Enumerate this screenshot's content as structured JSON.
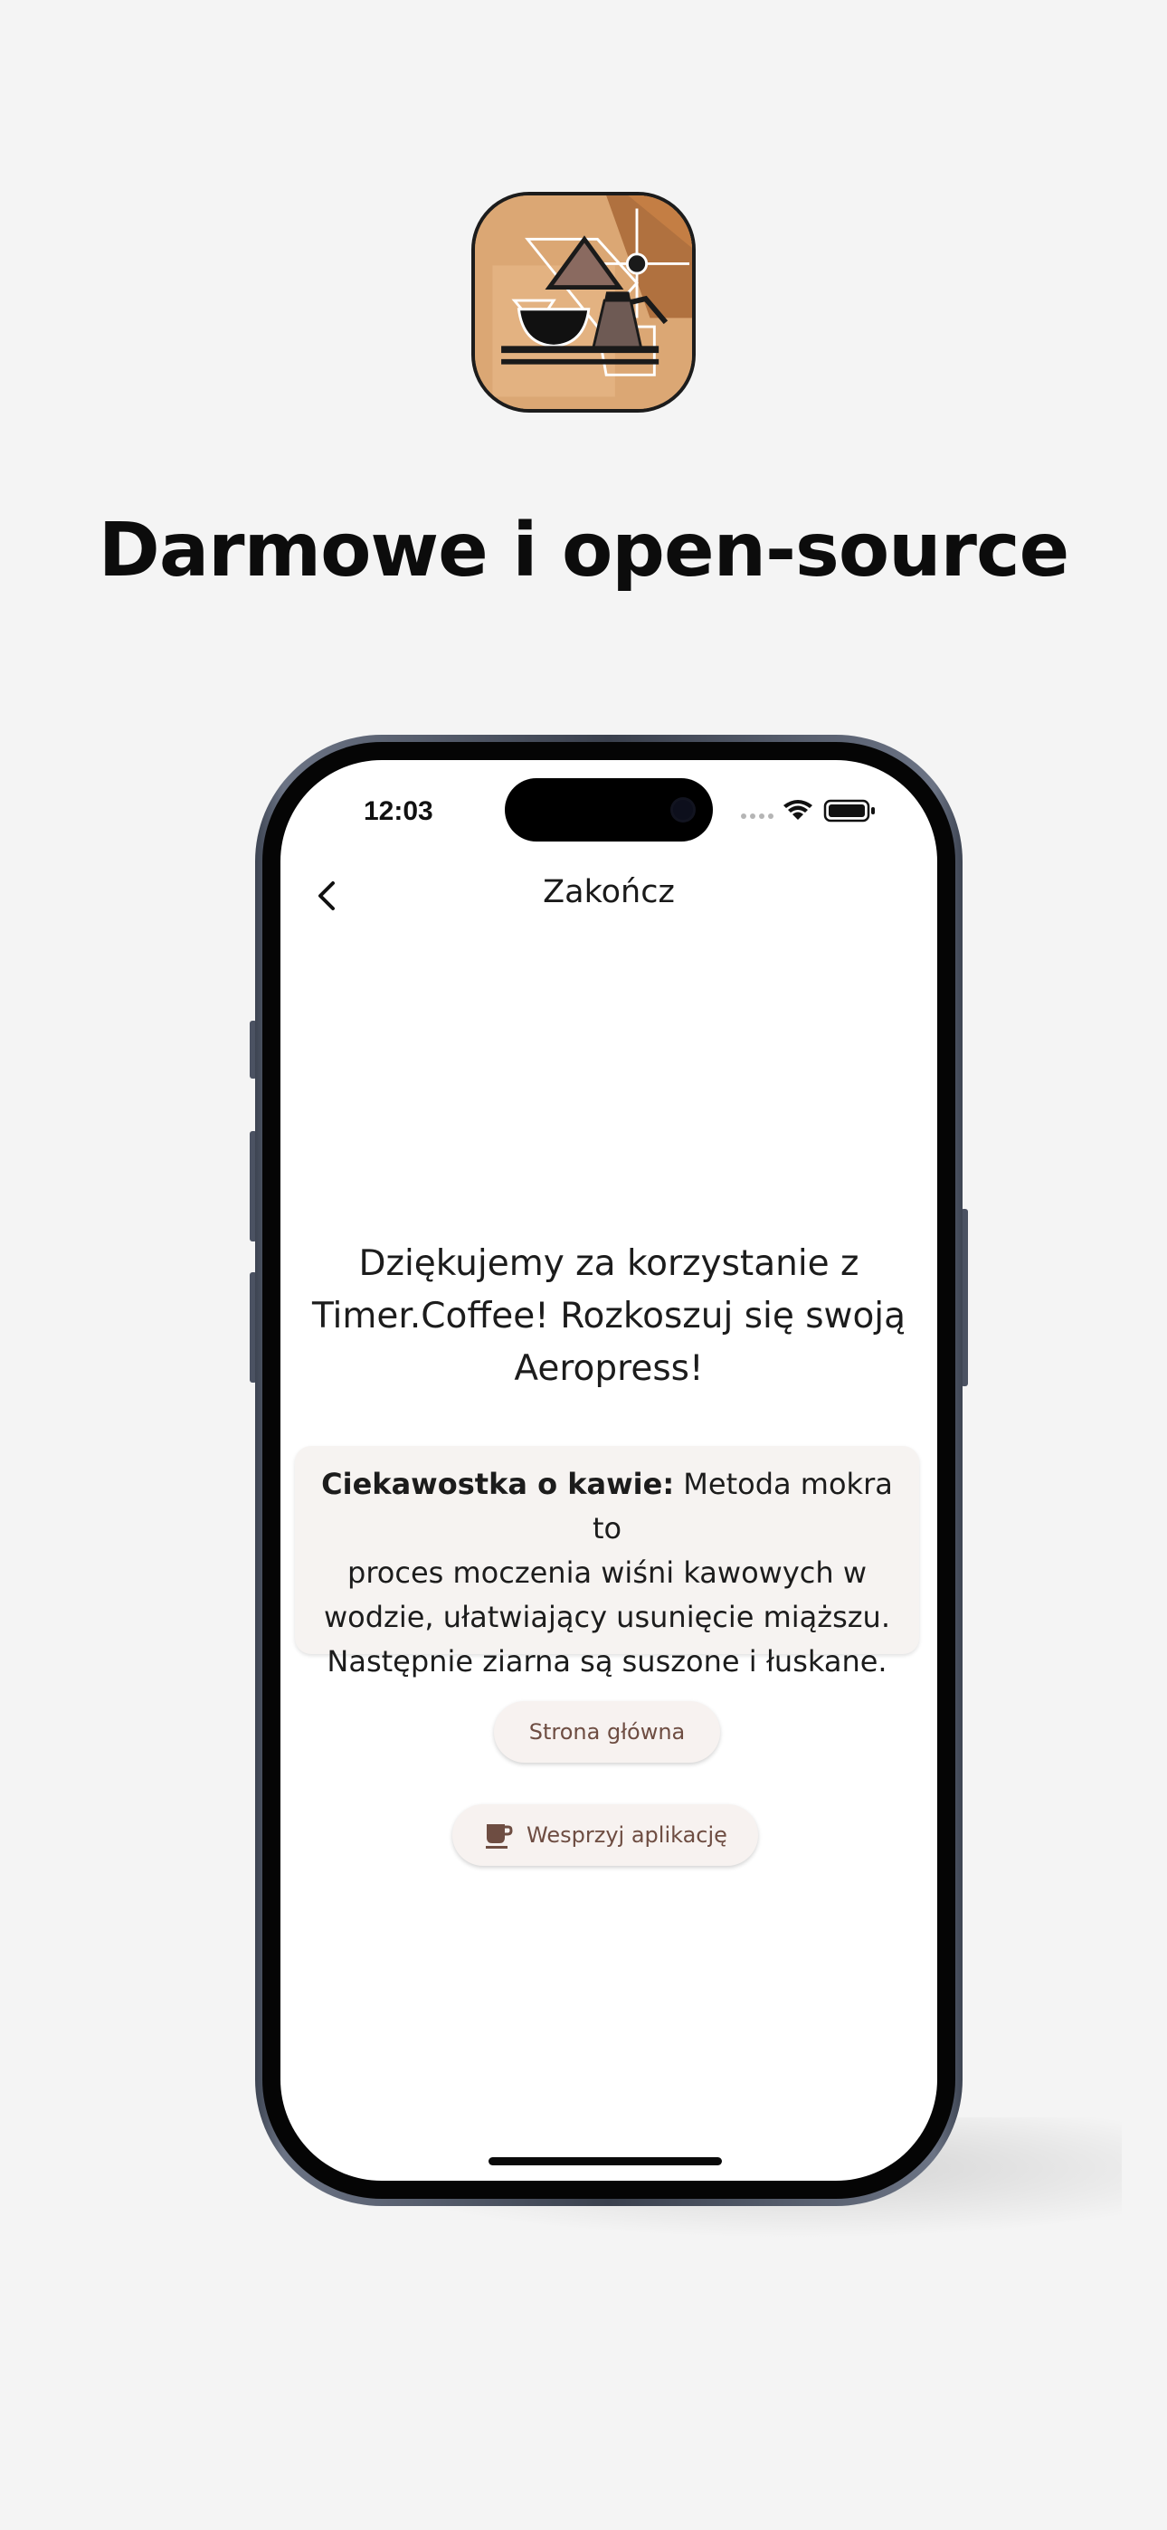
{
  "headline": "Darmowe i open-source",
  "status_bar": {
    "time": "12:03"
  },
  "nav": {
    "title": "Zakończ"
  },
  "thanks_message": {
    "line1": "Dziękujemy za korzystanie z",
    "line2": "Timer.Coffee! Rozkoszuj się swoją",
    "line3": "Aeropress!"
  },
  "fact_card": {
    "label": "Ciekawostka o kawie:",
    "text_part1": "Metoda mokra to",
    "line2": "proces moczenia wiśni kawowych w",
    "line3": "wodzie, ułatwiający usunięcie miąższu.",
    "line4": "Następnie ziarna są suszone i łuskane."
  },
  "buttons": {
    "home_label": "Strona główna",
    "support_label": "Wesprzyj aplikację"
  },
  "colors": {
    "background": "#f4f4f4",
    "button_text": "#6e4d42",
    "button_bg": "#f7f2f0",
    "card_bg": "#f6f3f1",
    "icon_tan": "#dba774",
    "icon_brown": "#b0713f"
  }
}
